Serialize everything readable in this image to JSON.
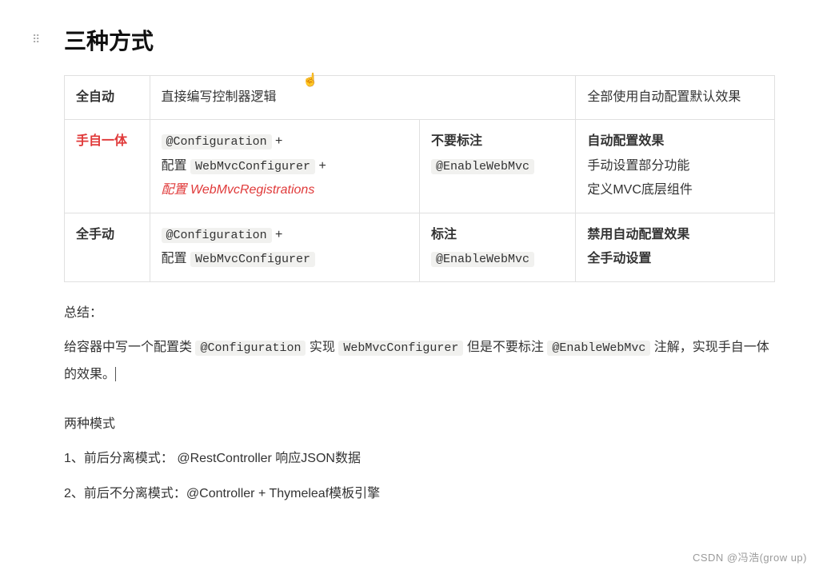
{
  "title": "三种方式",
  "table": {
    "rows": [
      {
        "label": "全自动",
        "col2": "直接编写控制器逻辑",
        "col3": "",
        "col4": "全部使用自动配置默认效果"
      },
      {
        "label": "手自一体",
        "col2_code1": "@Configuration",
        "col2_plus1": " +",
        "col2_prefix2": "配置 ",
        "col2_code2": "WebMvcConfigurer",
        "col2_plus2": " +",
        "col2_line3_prefix": "配置 ",
        "col2_line3_red": "WebMvcRegistrations",
        "col3_label": "不要标注",
        "col3_code": "@EnableWebMvc",
        "col4_line1": "自动配置效果",
        "col4_line2": "手动设置部分功能",
        "col4_line3": "定义MVC底层组件"
      },
      {
        "label": "全手动",
        "col2_code1": "@Configuration",
        "col2_plus1": " +",
        "col2_prefix2": "配置 ",
        "col2_code2": "WebMvcConfigurer",
        "col3_label": "标注",
        "col3_code": "@EnableWebMvc",
        "col4_line1": "禁用自动配置效果",
        "col4_line2": "全手动设置"
      }
    ]
  },
  "summary": {
    "heading": "总结：",
    "line_pre": "给容器中写一个配置类 ",
    "code1": "@Configuration",
    "mid1": " 实现 ",
    "code2": "WebMvcConfigurer",
    "mid2": " 但是不要标注 ",
    "code3": "@EnableWebMvc",
    "tail": " 注解，实现手自一体的效果。",
    "modes_heading": "两种模式",
    "mode1": "1、前后分离模式： @RestController 响应JSON数据",
    "mode2": "2、前后不分离模式：@Controller + Thymeleaf模板引擎"
  },
  "watermark": "CSDN @冯浩(grow up)"
}
